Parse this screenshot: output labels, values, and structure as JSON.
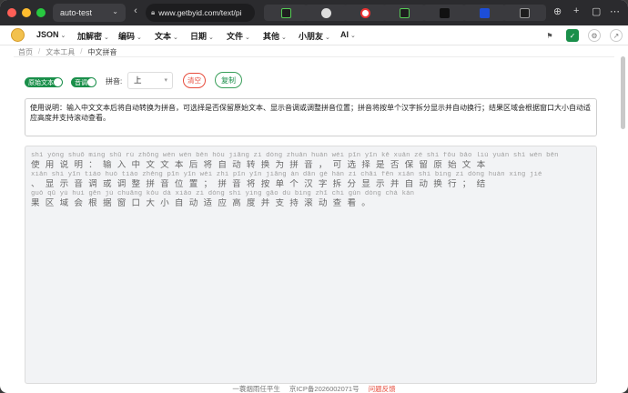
{
  "window": {
    "tab_title": "auto-test",
    "url": "www.getbyid.com/text/pi"
  },
  "menu": {
    "items": [
      {
        "label": "JSON"
      },
      {
        "label": "加解密"
      },
      {
        "label": "编码"
      },
      {
        "label": "文本"
      },
      {
        "label": "日期"
      },
      {
        "label": "文件"
      },
      {
        "label": "其他"
      },
      {
        "label": "小朋友"
      },
      {
        "label": "AI"
      }
    ]
  },
  "breadcrumb": {
    "home": "首页",
    "tools": "文本工具",
    "current": "中文拼音"
  },
  "controls": {
    "keep_original_label": "原始文本",
    "tone_label": "音调",
    "pinyin_label": "拼音:",
    "position_value": "上",
    "clear_label": "清空",
    "copy_label": "复制"
  },
  "input": {
    "text": "使用说明：输入中文文本后将自动转换为拼音，可选择是否保留原始文本、显示音调或调整拼音位置；拼音将按单个汉字拆分显示并自动换行；结果区域会根据窗口大小自动适应高度并支持滚动查看。"
  },
  "output": {
    "lines": [
      {
        "pinyin": "shǐ yòng shuō míng   shū rù zhōng wén wén běn hòu jiāng zì dòng zhuǎn huàn wéi pīn yīn   kě xuǎn zé shì fǒu bǎo liú yuán shǐ wén běn",
        "chars": "使用说明：输入中文文本后将自动转换为拼音，可选择是否保留原始文本"
      },
      {
        "pinyin": "  xiǎn shì yīn tiáo huò tiáo zhěng pīn yīn wèi zhì   pīn yīn jiāng àn dān gè hàn zì chāi fēn xiǎn shì bìng zì dòng huàn xíng   jié",
        "chars": "、显示音调或调整拼音位置；拼音将按单个汉字拆分显示并自动换行；结"
      },
      {
        "pinyin": "guǒ qū yù huì gēn jù chuāng kǒu dà xiǎo zì dòng shì yìng gāo dù bìng zhī chí gǔn dòng chá kàn",
        "chars": "果区域会根据窗口大小自动适应高度并支持滚动查看。"
      }
    ]
  },
  "footer": {
    "author": "一蓑烟雨任平生",
    "icp": "京ICP备2026002071号",
    "feedback": "问题反馈"
  },
  "colors": {
    "accent_green": "#1a8f4a",
    "danger_red": "#e74c3c"
  }
}
